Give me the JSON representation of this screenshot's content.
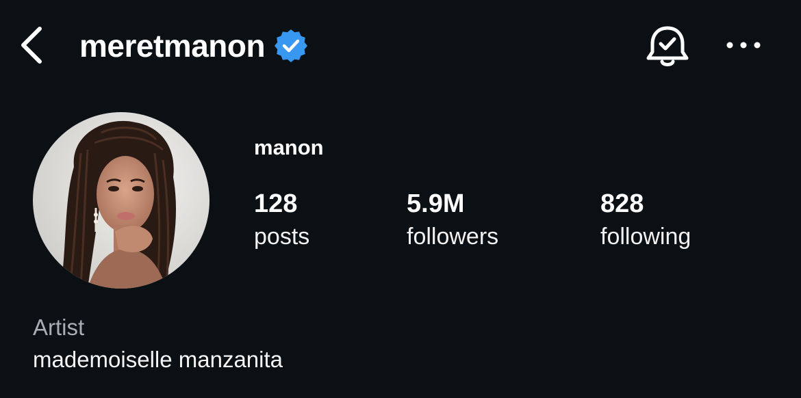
{
  "header": {
    "username": "meretmanon",
    "verified_color": "#3897f0"
  },
  "icons": {
    "back": "chevron-left-icon",
    "verified": "verified-badge-icon",
    "notifications": "bell-check-icon",
    "more": "more-horizontal-icon"
  },
  "profile": {
    "display_name": "manon",
    "stats": [
      {
        "value": "128",
        "label": "posts"
      },
      {
        "value": "5.9M",
        "label": "followers"
      },
      {
        "value": "828",
        "label": "following"
      }
    ],
    "category": "Artist",
    "bio": "mademoiselle manzanita"
  },
  "colors": {
    "background": "#0b1014",
    "text_primary": "#ffffff",
    "text_secondary": "#a8aeb5"
  }
}
